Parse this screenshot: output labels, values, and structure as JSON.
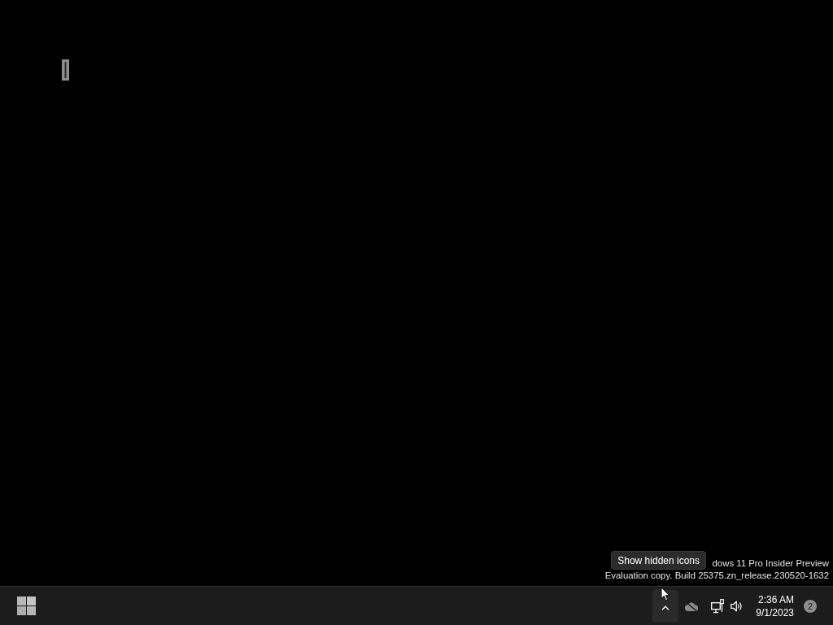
{
  "desktop": {
    "watermark": [
      "dows 11 Pro Insider Preview",
      "Evaluation copy. Build 25375.zn_release.230520-1632"
    ],
    "tooltip": {
      "text": "Show hidden icons"
    }
  },
  "taskbar": {
    "show_hidden_button": {
      "hovered": true
    },
    "clock": {
      "time": "2:36 AM",
      "date": "9/1/2023"
    },
    "notifications": {
      "count": "2"
    }
  }
}
